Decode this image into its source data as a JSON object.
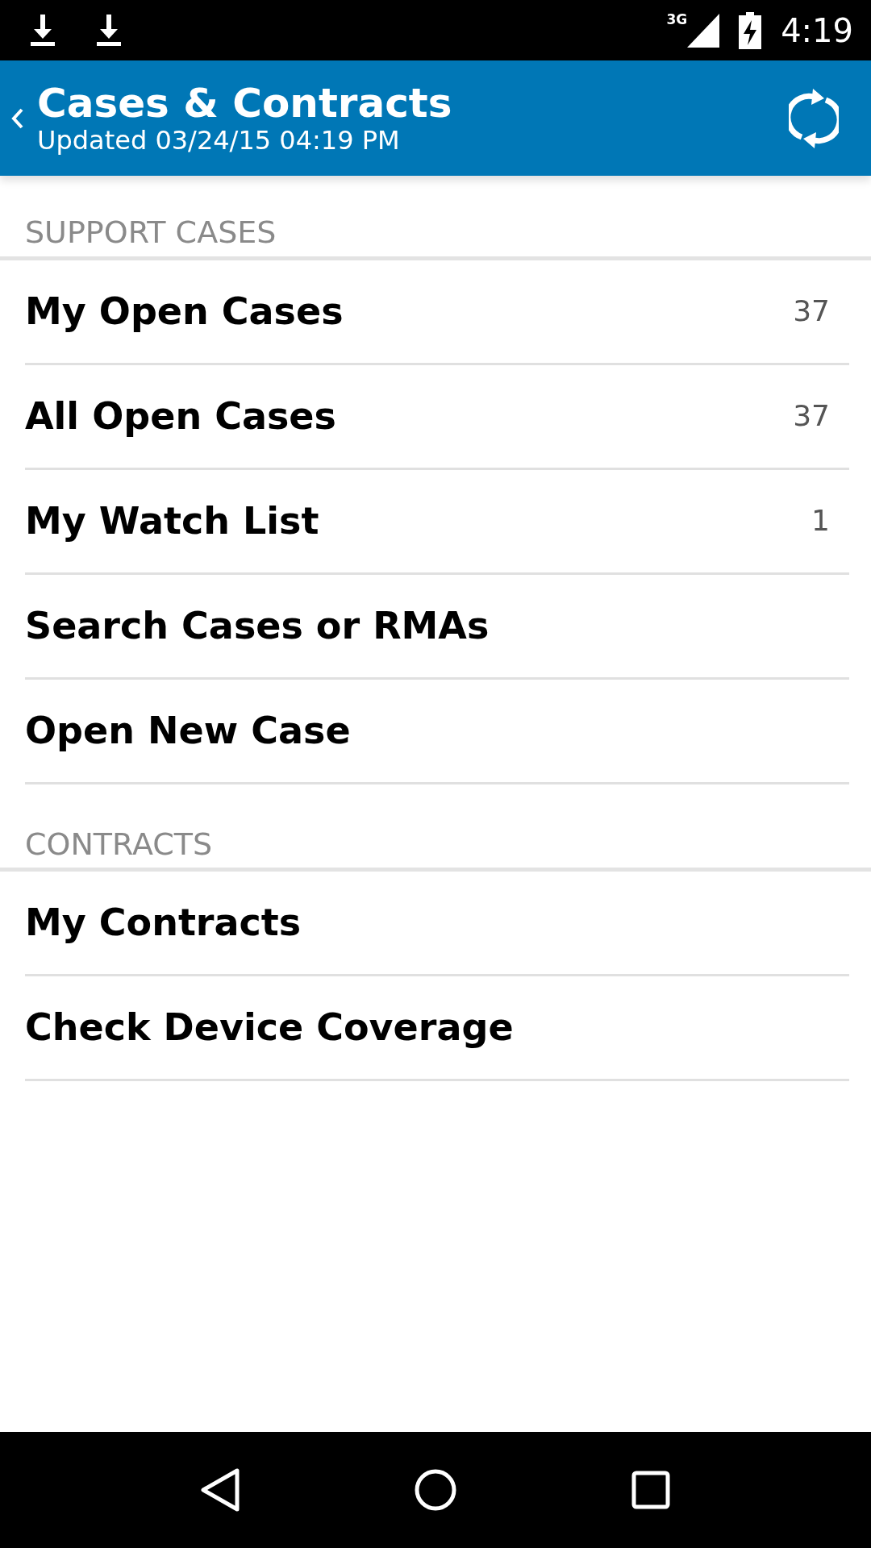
{
  "status_bar": {
    "network": "3G",
    "time": "4:19"
  },
  "header": {
    "title": "Cases & Contracts",
    "subtitle": "Updated 03/24/15 04:19 PM"
  },
  "sections": [
    {
      "title": "SUPPORT CASES",
      "items": [
        {
          "label": "My Open Cases",
          "count": "37"
        },
        {
          "label": "All Open Cases",
          "count": "37"
        },
        {
          "label": "My Watch List",
          "count": "1"
        },
        {
          "label": "Search Cases or RMAs"
        },
        {
          "label": "Open New Case"
        }
      ]
    },
    {
      "title": "CONTRACTS",
      "items": [
        {
          "label": "My Contracts"
        },
        {
          "label": "Check Device Coverage"
        }
      ]
    }
  ]
}
